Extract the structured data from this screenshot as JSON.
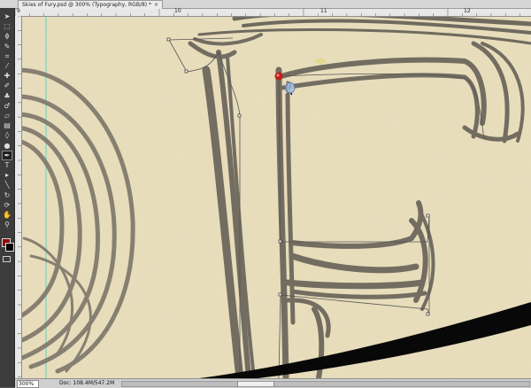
{
  "document": {
    "tab_title": "Skies of Fury.psd @ 300% (Typography, RGB/8) *",
    "close_glyph": "×"
  },
  "rulers": {
    "top_labels": [
      "9",
      "10",
      "11",
      "12"
    ]
  },
  "tools": [
    {
      "name": "move-tool-icon",
      "glyph": "➤"
    },
    {
      "name": "marquee-tool-icon",
      "glyph": "⬚"
    },
    {
      "name": "lasso-tool-icon",
      "glyph": "ϕ"
    },
    {
      "name": "quick-select-tool-icon",
      "glyph": "✎"
    },
    {
      "name": "crop-tool-icon",
      "glyph": "⌗"
    },
    {
      "name": "eyedropper-tool-icon",
      "glyph": "⁄"
    },
    {
      "name": "healing-brush-tool-icon",
      "glyph": "✚"
    },
    {
      "name": "brush-tool-icon",
      "glyph": "✐"
    },
    {
      "name": "clone-stamp-tool-icon",
      "glyph": "♣"
    },
    {
      "name": "history-brush-tool-icon",
      "glyph": "♂"
    },
    {
      "name": "eraser-tool-icon",
      "glyph": "▱"
    },
    {
      "name": "gradient-tool-icon",
      "glyph": "▤"
    },
    {
      "name": "blur-tool-icon",
      "glyph": "◊"
    },
    {
      "name": "dodge-tool-icon",
      "glyph": "●"
    },
    {
      "name": "pen-tool-icon",
      "glyph": "✒"
    },
    {
      "name": "type-tool-icon",
      "glyph": "T"
    },
    {
      "name": "path-selection-tool-icon",
      "glyph": "▸"
    },
    {
      "name": "line-tool-icon",
      "glyph": "╲"
    },
    {
      "name": "3d-rotate-tool-icon",
      "glyph": "↻"
    },
    {
      "name": "3d-orbit-tool-icon",
      "glyph": "⟳"
    },
    {
      "name": "hand-tool-icon",
      "glyph": "✋"
    },
    {
      "name": "zoom-tool-icon",
      "glyph": "⚲"
    }
  ],
  "active_tool": "pen-tool-icon",
  "colors": {
    "foreground": "#8b0000",
    "background": "#000000",
    "paper": "#e9dfbd",
    "sketch": "#7d776a",
    "path": "#555555",
    "anchor_red": "#c0201c"
  },
  "status": {
    "zoom": "300%",
    "doc_info": "Doc: 108.4M/547.2M"
  }
}
